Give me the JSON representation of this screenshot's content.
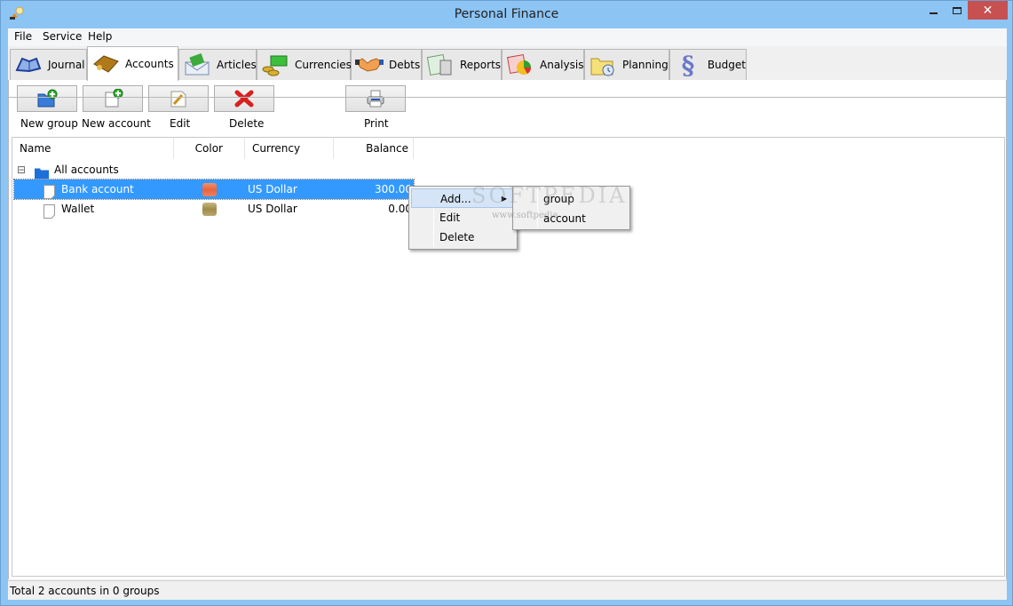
{
  "window": {
    "title": "Personal Finance",
    "controls": {
      "minimize": "minimize",
      "maximize": "maximize",
      "close": "✕"
    }
  },
  "menu": [
    {
      "label": "File"
    },
    {
      "label": "Service"
    },
    {
      "label": "Help"
    }
  ],
  "tabs": [
    {
      "label": "Journal",
      "icon": "book-icon",
      "active": false
    },
    {
      "label": "Accounts",
      "icon": "wallet-icon",
      "active": true
    },
    {
      "label": "Articles",
      "icon": "envelope-money-icon",
      "active": false
    },
    {
      "label": "Currencies",
      "icon": "coins-icon",
      "active": false
    },
    {
      "label": "Debts",
      "icon": "handshake-icon",
      "active": false
    },
    {
      "label": "Reports",
      "icon": "report-calculator-icon",
      "active": false
    },
    {
      "label": "Analysis",
      "icon": "pie-chart-icon",
      "active": false
    },
    {
      "label": "Planning",
      "icon": "folder-clock-icon",
      "active": false
    },
    {
      "label": "Budget",
      "icon": "section-sign-icon",
      "active": false
    }
  ],
  "toolbar": {
    "new_group": "New group",
    "new_account": "New account",
    "edit": "Edit",
    "delete": "Delete",
    "print": "Print"
  },
  "grid": {
    "columns": [
      "Name",
      "Color",
      "Currency",
      "Balance"
    ],
    "root": {
      "label": "All accounts",
      "expand_glyph": "⊟"
    },
    "rows": [
      {
        "name": "Bank account",
        "color": "#e8643c",
        "currency": "US Dollar",
        "balance": "300.00",
        "selected": true
      },
      {
        "name": "Wallet",
        "color": "#a08a4a",
        "currency": "US Dollar",
        "balance": "0.00",
        "selected": false
      }
    ]
  },
  "context_menu": {
    "items": [
      {
        "label": "Add...",
        "has_submenu": true,
        "highlighted": true
      },
      {
        "label": "Edit"
      },
      {
        "label": "Delete"
      }
    ],
    "submenu": [
      {
        "label": "group"
      },
      {
        "label": "account"
      }
    ]
  },
  "watermark": {
    "text": "SOFTPEDIA",
    "url": "www.softpedia"
  },
  "status": {
    "text": "Total 2 accounts in 0 groups"
  }
}
